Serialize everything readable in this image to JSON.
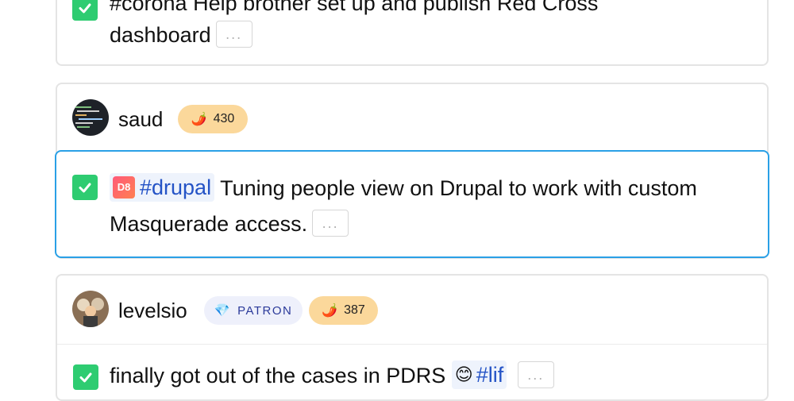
{
  "posts": [
    {
      "partial_text": "#corona Help brother set up and publish Red Cross",
      "line2": "dashboard",
      "more_label": "..."
    },
    {
      "user": {
        "name": "saud",
        "karma": "430",
        "avatar_icon": "avatar-image"
      },
      "tag": {
        "badge": "D8",
        "label": "#drupal"
      },
      "line1": "Tuning people view on Drupal to work with custom",
      "line2": "Masquerade access.",
      "more_label": "..."
    },
    {
      "user": {
        "name": "levelsio",
        "patron_label": "PATRON",
        "karma": "387",
        "avatar_icon": "avatar-image"
      },
      "partial_text": "finally got out of the cases in PDRS",
      "tag_label": "#lif",
      "more_label": "..."
    }
  ],
  "colors": {
    "accent_border": "#2aa0e6",
    "check_green": "#2ecc71",
    "karma_bg": "#fbd89b"
  }
}
